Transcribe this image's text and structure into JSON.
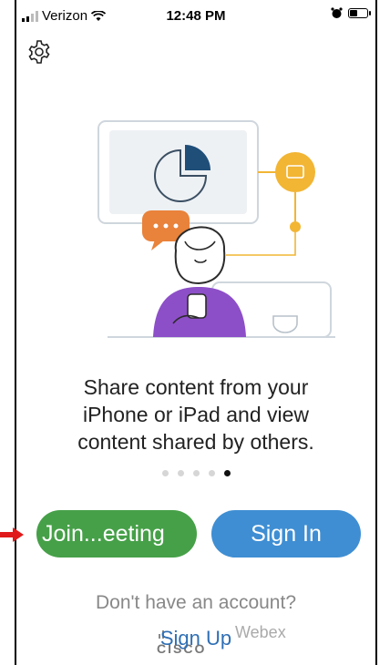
{
  "status_bar": {
    "carrier": "Verizon",
    "time": "12:48 PM"
  },
  "settings": {
    "icon": "gear-icon"
  },
  "onboarding": {
    "headline": "Share content from your iPhone or iPad and view content shared by others.",
    "page_count": 5,
    "active_page": 5
  },
  "actions": {
    "join_label": "Join...eeting",
    "signin_label": "Sign In"
  },
  "account": {
    "prompt": "Don't have an account?",
    "signup_label": "Sign Up"
  },
  "branding": {
    "company": "CISCO",
    "product": "Webex"
  },
  "colors": {
    "join_green": "#46a048",
    "signin_blue": "#3f8ed3",
    "accent_orange": "#e9823a",
    "accent_yellow": "#f2b534",
    "arrow_red": "#e01a1a"
  }
}
